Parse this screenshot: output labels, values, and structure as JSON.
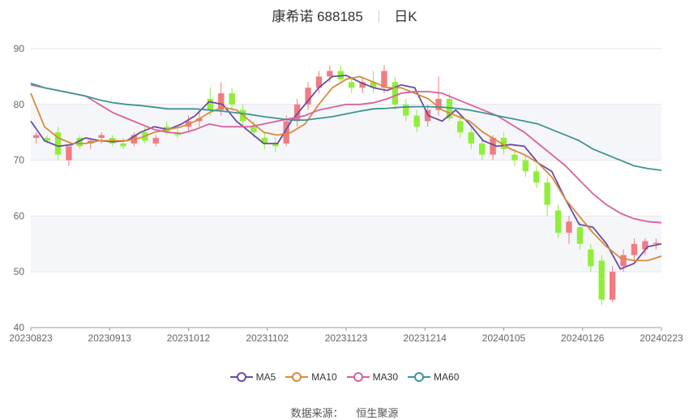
{
  "title": {
    "name": "康希诺 688185",
    "period": "日K"
  },
  "chart_data": {
    "type": "candlestick",
    "x_labels": [
      "20230823",
      "20230913",
      "20231012",
      "20231102",
      "20231123",
      "20231214",
      "20240105",
      "20240126",
      "20240223"
    ],
    "y_ticks": [
      40,
      50,
      60,
      70,
      80,
      90
    ],
    "ylim": [
      40,
      90
    ],
    "grid": true,
    "legend_position": "bottom",
    "colors": {
      "up": "#f07c82",
      "down": "#90ee3a",
      "MA5": "#6b4ba1",
      "MA10": "#d98a3a",
      "MA30": "#d9609f",
      "MA60": "#3f9494"
    },
    "series": [
      {
        "name": "MA5",
        "values": [
          77.0,
          73.5,
          72.5,
          72.8,
          74.0,
          73.5,
          73.3,
          73.5,
          75.0,
          76.0,
          75.5,
          76.5,
          78.0,
          80.5,
          80.0,
          77.0,
          75.0,
          73.0,
          73.0,
          77.0,
          80.0,
          83.0,
          85.0,
          85.2,
          84.0,
          83.0,
          82.5,
          83.5,
          83.0,
          78.0,
          77.0,
          79.0,
          76.5,
          73.5,
          72.5,
          72.8,
          72.5,
          69.5,
          68.0,
          63.0,
          58.5,
          58.0,
          55.0,
          50.5,
          51.5,
          54.5,
          55.0
        ]
      },
      {
        "name": "MA10",
        "values": [
          82.0,
          76.0,
          74.0,
          73.0,
          73.0,
          73.5,
          73.5,
          73.5,
          74.0,
          75.0,
          75.5,
          76.0,
          77.0,
          78.5,
          79.5,
          79.0,
          77.0,
          75.0,
          74.5,
          75.0,
          76.5,
          80.0,
          83.0,
          84.5,
          85.0,
          84.0,
          83.0,
          83.0,
          82.0,
          81.0,
          79.0,
          78.0,
          77.0,
          75.0,
          73.5,
          72.0,
          71.0,
          69.5,
          67.0,
          63.0,
          60.0,
          57.0,
          54.5,
          52.5,
          52.0,
          52.0,
          52.8
        ]
      },
      {
        "name": "MA30",
        "values": [
          83.5,
          83.0,
          82.5,
          82.0,
          81.5,
          80.0,
          78.5,
          77.5,
          76.5,
          75.5,
          75.0,
          74.8,
          75.5,
          76.5,
          76.0,
          76.0,
          76.0,
          76.5,
          77.0,
          77.5,
          78.0,
          79.0,
          79.5,
          80.0,
          80.0,
          80.3,
          81.0,
          82.0,
          82.3,
          82.3,
          82.0,
          81.0,
          80.0,
          79.0,
          78.0,
          76.5,
          75.0,
          73.0,
          71.0,
          69.0,
          66.5,
          64.0,
          62.0,
          60.5,
          59.5,
          59.0,
          58.8
        ]
      },
      {
        "name": "MA60",
        "values": [
          83.8,
          83.0,
          82.5,
          82.0,
          81.5,
          80.8,
          80.3,
          80.0,
          79.8,
          79.5,
          79.2,
          79.2,
          79.2,
          79.0,
          78.8,
          78.5,
          78.2,
          77.8,
          77.5,
          77.2,
          77.2,
          77.5,
          77.8,
          78.3,
          78.8,
          79.2,
          79.3,
          79.5,
          79.6,
          79.6,
          79.5,
          79.3,
          79.0,
          78.5,
          78.0,
          77.5,
          77.0,
          76.5,
          75.5,
          74.5,
          73.5,
          72.0,
          71.0,
          70.0,
          69.0,
          68.5,
          68.2
        ]
      }
    ],
    "candles": [
      [
        74,
        75,
        73,
        74.5
      ],
      [
        74,
        74.5,
        73,
        73.5
      ],
      [
        75,
        76,
        70,
        71
      ],
      [
        70,
        72,
        69,
        72.5
      ],
      [
        74,
        74.5,
        72,
        72.5
      ],
      [
        73,
        74,
        72,
        73.5
      ],
      [
        74,
        75,
        73,
        74.5
      ],
      [
        74,
        74.5,
        72.5,
        73
      ],
      [
        73,
        74,
        72,
        72.5
      ],
      [
        73,
        75,
        72.5,
        74.5
      ],
      [
        75,
        76,
        73,
        73.5
      ],
      [
        73,
        74.5,
        72.5,
        74
      ],
      [
        76,
        77,
        74.5,
        75
      ],
      [
        75,
        76,
        74,
        74.5
      ],
      [
        76,
        78,
        75,
        77
      ],
      [
        77,
        78.5,
        76,
        77.5
      ],
      [
        81,
        83,
        78,
        79
      ],
      [
        79,
        84,
        78,
        82
      ],
      [
        82,
        83,
        79,
        80
      ],
      [
        79,
        80,
        76,
        77
      ],
      [
        76,
        77,
        74,
        75
      ],
      [
        74,
        75,
        72,
        73
      ],
      [
        73,
        74,
        71.5,
        72.5
      ],
      [
        73,
        78,
        72.5,
        77
      ],
      [
        77,
        81,
        76,
        80
      ],
      [
        80,
        84,
        79,
        83
      ],
      [
        83,
        86,
        82,
        85
      ],
      [
        85,
        87,
        84,
        86
      ],
      [
        86,
        87,
        84,
        84.5
      ],
      [
        84,
        85,
        82,
        83
      ],
      [
        83,
        85,
        82,
        84
      ],
      [
        84,
        86,
        82,
        83
      ],
      [
        83,
        87,
        82,
        86
      ],
      [
        84,
        85,
        79,
        80
      ],
      [
        80,
        81,
        77,
        78
      ],
      [
        78,
        79,
        75,
        76
      ],
      [
        77,
        80,
        76,
        79
      ],
      [
        79,
        85,
        78,
        81
      ],
      [
        81,
        82,
        77,
        77.5
      ],
      [
        77,
        78,
        74,
        75
      ],
      [
        75,
        76,
        72,
        73
      ],
      [
        73,
        74,
        70,
        71
      ],
      [
        71,
        74.5,
        70,
        74
      ],
      [
        74,
        75,
        71,
        72
      ],
      [
        71,
        72,
        69,
        70
      ],
      [
        70,
        71,
        67,
        68
      ],
      [
        68,
        69,
        65,
        66
      ],
      [
        66,
        67,
        60,
        62
      ],
      [
        61,
        62,
        56,
        57
      ],
      [
        57,
        60,
        55,
        59
      ],
      [
        58,
        59,
        54,
        55
      ],
      [
        54,
        55,
        50,
        51
      ],
      [
        52,
        53,
        44,
        45
      ],
      [
        45,
        51,
        44.5,
        50
      ],
      [
        51,
        54,
        50,
        53
      ],
      [
        53,
        56,
        52,
        55
      ],
      [
        54,
        56,
        53,
        55.5
      ],
      [
        55,
        56,
        54,
        55.2
      ]
    ]
  },
  "legend": [
    {
      "label": "MA5",
      "color": "#6b4ba1"
    },
    {
      "label": "MA10",
      "color": "#d98a3a"
    },
    {
      "label": "MA30",
      "color": "#d9609f"
    },
    {
      "label": "MA60",
      "color": "#3f9494"
    }
  ],
  "source": {
    "label": "数据来源：",
    "value": "恒生聚源"
  }
}
